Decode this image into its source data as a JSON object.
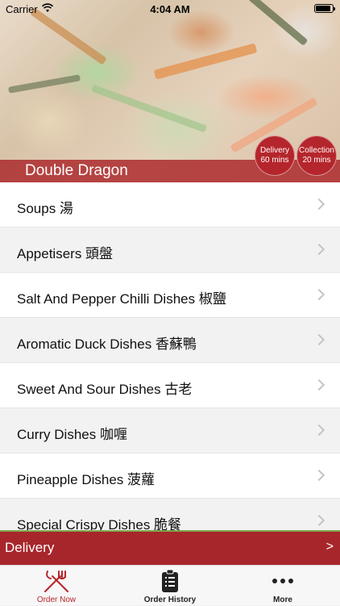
{
  "status_bar": {
    "carrier": "Carrier",
    "time": "4:04 AM"
  },
  "header": {
    "restaurant_name": "Double Dragon",
    "delivery_badge": {
      "title": "Delivery",
      "time": "60 mins"
    },
    "collection_badge": {
      "title": "Collection",
      "time": "20 mins"
    }
  },
  "menu": {
    "items": [
      {
        "label": "Soups 湯"
      },
      {
        "label": "Appetisers 頭盤"
      },
      {
        "label": "Salt And Pepper Chilli Dishes 椒鹽"
      },
      {
        "label": "Aromatic Duck Dishes 香蘇鴨"
      },
      {
        "label": "Sweet And Sour Dishes 古老"
      },
      {
        "label": "Curry Dishes 咖喱"
      },
      {
        "label": "Pineapple Dishes 菠蘿"
      },
      {
        "label": "Special Crispy Dishes 脆餐"
      }
    ]
  },
  "order_mode_bar": {
    "label": "Delivery",
    "arrow": ">"
  },
  "tab_bar": {
    "tabs": [
      {
        "label": "Order Now",
        "icon": "fork-knife-icon",
        "active": true
      },
      {
        "label": "Order History",
        "icon": "clipboard-list-icon",
        "active": false
      },
      {
        "label": "More",
        "icon": "more-dots-icon",
        "active": false
      }
    ]
  },
  "colors": {
    "brand_red": "#b5262c",
    "accent_green": "#7fa64a",
    "active_tab": "#b5262c"
  }
}
